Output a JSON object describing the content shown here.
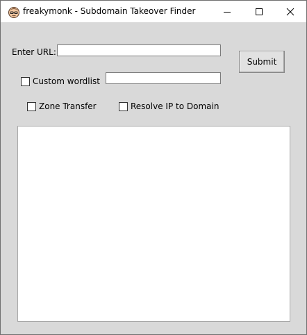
{
  "window": {
    "title": "freakymonk - Subdomain Takeover Finder",
    "icon": "monk-face-icon",
    "controls": {
      "minimize": "minimize-icon",
      "maximize": "maximize-icon",
      "close": "close-icon"
    }
  },
  "form": {
    "url_label": "Enter URL:",
    "url_value": "",
    "submit_label": "Submit",
    "custom_wordlist_label": "Custom wordlist",
    "custom_wordlist_checked": false,
    "wordlist_value": "",
    "zone_transfer_label": "Zone Transfer",
    "zone_transfer_checked": false,
    "resolve_ip_label": "Resolve IP to Domain",
    "resolve_ip_checked": false
  },
  "output": {
    "text": ""
  }
}
